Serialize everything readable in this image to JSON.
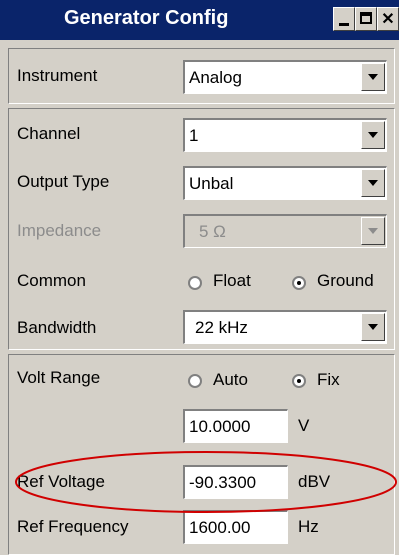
{
  "window": {
    "title": "Generator Config"
  },
  "instrument": {
    "label": "Instrument",
    "value": "Analog"
  },
  "channel": {
    "label": "Channel",
    "value": "1"
  },
  "output_type": {
    "label": "Output Type",
    "value": "Unbal"
  },
  "impedance": {
    "label": "Impedance",
    "value": "5 Ω",
    "disabled": true
  },
  "common": {
    "label": "Common",
    "options": [
      "Float",
      "Ground"
    ],
    "selected": "Ground"
  },
  "bandwidth": {
    "label": "Bandwidth",
    "value": "22 kHz"
  },
  "volt_range": {
    "label": "Volt Range",
    "options": [
      "Auto",
      "Fix"
    ],
    "selected": "Fix",
    "value": "10.0000",
    "unit": "V"
  },
  "ref_voltage": {
    "label": "Ref Voltage",
    "value": "-90.3300",
    "unit": "dBV"
  },
  "ref_frequency": {
    "label": "Ref Frequency",
    "value": "1600.00",
    "unit": "Hz"
  },
  "colors": {
    "title_bg": "#0a246a",
    "window_bg": "#d4d0c8",
    "highlight_ellipse": "#d00000"
  }
}
